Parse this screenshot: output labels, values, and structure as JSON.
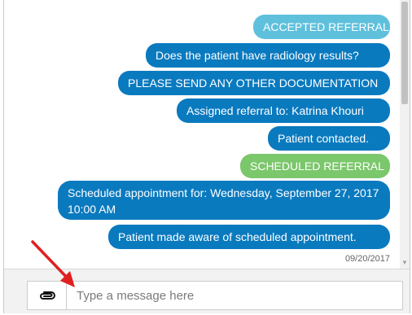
{
  "messages": [
    {
      "text": "ACCEPTED REFERRAL",
      "kind": "status-accepted"
    },
    {
      "text": "Does the patient have radiology results?",
      "kind": "message"
    },
    {
      "text": "PLEASE SEND ANY OTHER DOCUMENTATION",
      "kind": "message"
    },
    {
      "text": "Assigned referral to: Katrina Khouri",
      "kind": "message"
    },
    {
      "text": "Patient contacted.",
      "kind": "message"
    },
    {
      "text": "SCHEDULED REFERRAL",
      "kind": "status-scheduled"
    },
    {
      "text": "Scheduled appointment for: Wednesday, September 27, 2017 10:00 AM",
      "kind": "message"
    },
    {
      "text": "Patient made aware of scheduled appointment.",
      "kind": "message"
    }
  ],
  "date": "09/20/2017",
  "composer": {
    "placeholder": "Type a message here",
    "attach_icon": "paperclip-icon"
  },
  "colors": {
    "message_bubble": "#0a7abf",
    "accepted_bubble": "#5fc0dc",
    "scheduled_bubble": "#7bc76b",
    "annotation_arrow": "#e02020"
  }
}
